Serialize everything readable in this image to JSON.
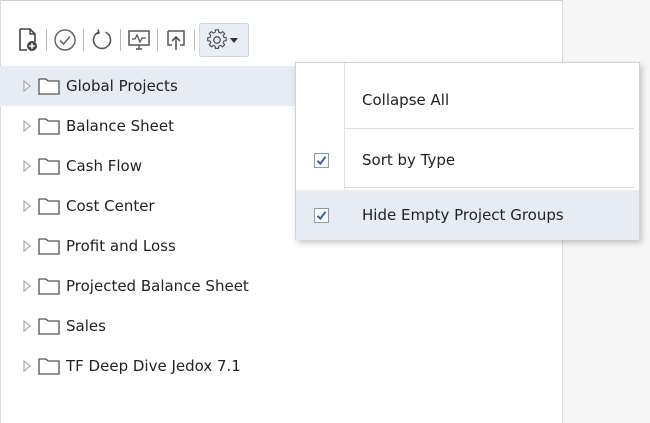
{
  "toolbar": {
    "buttons": [
      {
        "icon": "new-document-icon"
      },
      {
        "icon": "check-circle-icon"
      },
      {
        "icon": "refresh-icon"
      },
      {
        "icon": "monitor-icon"
      },
      {
        "icon": "publish-icon"
      },
      {
        "icon": "gear-icon"
      }
    ]
  },
  "tree": {
    "items": [
      {
        "label": "Global Projects",
        "selected": true
      },
      {
        "label": "Balance Sheet"
      },
      {
        "label": "Cash Flow"
      },
      {
        "label": "Cost Center"
      },
      {
        "label": "Profit and Loss"
      },
      {
        "label": "Projected Balance Sheet"
      },
      {
        "label": "Sales"
      },
      {
        "label": "TF Deep Dive Jedox 7.1"
      }
    ]
  },
  "menu": {
    "items": [
      {
        "label": "Collapse All",
        "checkbox": false
      },
      {
        "label": "Sort by Type",
        "checkbox": true,
        "checked": true
      },
      {
        "label": "Hide Empty Project Groups",
        "checkbox": true,
        "checked": true
      }
    ]
  },
  "colors": {
    "selection": "#e6ecf3",
    "check": "#2f63b8",
    "folder_stroke": "#555555"
  }
}
